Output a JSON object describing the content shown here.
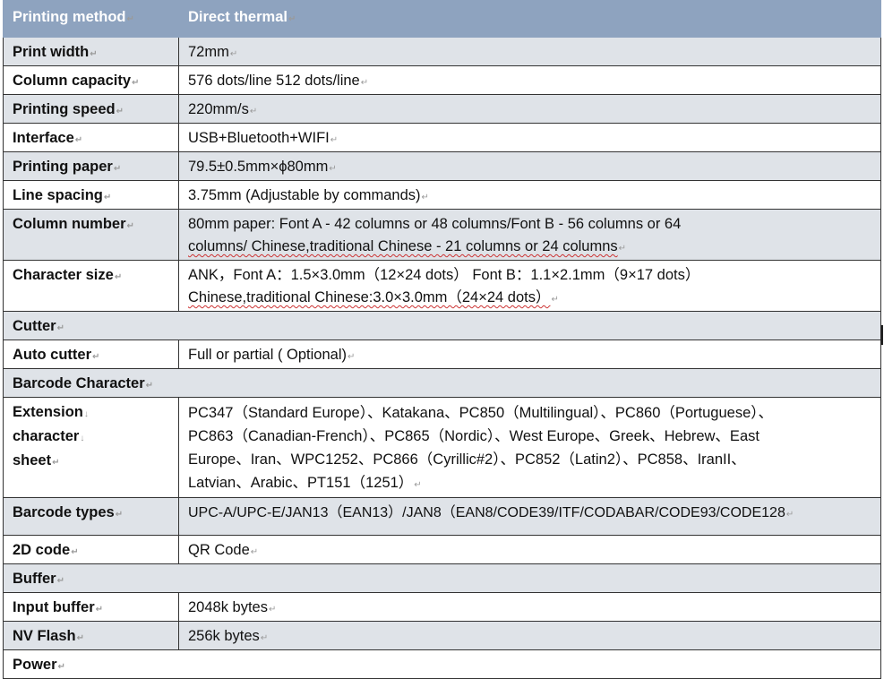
{
  "header": {
    "label": "Printing method",
    "value": "Direct thermal"
  },
  "rows": [
    {
      "label": "Print width",
      "lines": [
        "72mm"
      ]
    },
    {
      "label": "Column capacity",
      "lines": [
        "576 dots/line 512 dots/line"
      ]
    },
    {
      "label": "Printing speed",
      "lines": [
        "220mm/s"
      ]
    },
    {
      "label": "Interface",
      "lines": [
        "USB+Bluetooth+WIFI"
      ]
    },
    {
      "label": "Printing paper",
      "lines": [
        "79.5±0.5mm×ϕ80mm"
      ]
    },
    {
      "label": "Line spacing",
      "lines": [
        "3.75mm (Adjustable by commands)"
      ]
    },
    {
      "label": "Column number",
      "lines": [
        "80mm paper: Font A - 42 columns or 48 columns/Font B - 56 columns or 64",
        "columns/ Chinese,traditional Chinese - 21 columns or 24 columns"
      ]
    },
    {
      "label": "Character size",
      "lines": [
        "ANK，Font A：1.5×3.0mm（12×24 dots） Font B：1.1×2.1mm（9×17 dots）",
        "Chinese,traditional Chinese:3.0×3.0mm（24×24 dots）"
      ]
    },
    {
      "label": "Cutter"
    },
    {
      "label": "Auto cutter",
      "lines": [
        "Full or partial ( Optional)"
      ]
    },
    {
      "label": "Barcode Character"
    },
    {
      "label_lines": [
        "Extension",
        "character",
        "sheet"
      ],
      "lines": [
        "PC347（Standard Europe）、Katakana、PC850（Multilingual）、PC860（Portuguese）、",
        "PC863（Canadian-French）、PC865（Nordic）、West Europe、Greek、Hebrew、East",
        "Europe、Iran、WPC1252、PC866（Cyrillic#2）、PC852（Latin2）、PC858、IranII、",
        "Latvian、Arabic、PT151（1251）"
      ]
    },
    {
      "label": "Barcode types",
      "lines": [
        "UPC-A/UPC-E/JAN13（EAN13）/JAN8（EAN8/CODE39/ITF/CODABAR/CODE93/CODE128"
      ]
    },
    {
      "label": "2D code",
      "lines": [
        "QR Code"
      ]
    },
    {
      "label": "Buffer"
    },
    {
      "label": "Input buffer",
      "lines": [
        "2048k bytes"
      ]
    },
    {
      "label": "NV Flash",
      "lines": [
        "256k bytes"
      ]
    },
    {
      "label": "Power"
    }
  ]
}
